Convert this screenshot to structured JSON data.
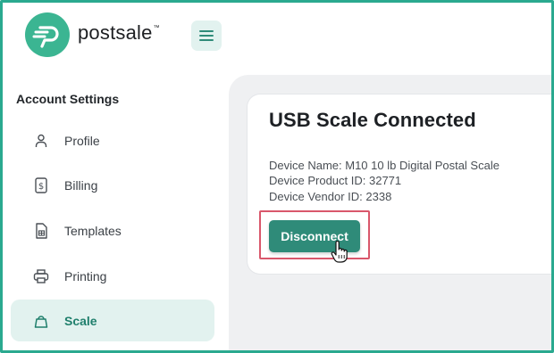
{
  "brand": {
    "name": "postsale",
    "trademark": "™",
    "accent": "#3bb592"
  },
  "header": {
    "menu_icon": "hamburger-icon"
  },
  "sidebar": {
    "title": "Account Settings",
    "items": [
      {
        "label": "Profile",
        "icon": "user-icon"
      },
      {
        "label": "Billing",
        "icon": "billing-icon"
      },
      {
        "label": "Templates",
        "icon": "template-icon"
      },
      {
        "label": "Printing",
        "icon": "printer-icon"
      },
      {
        "label": "Scale",
        "icon": "scale-icon",
        "active": true
      }
    ]
  },
  "main": {
    "card": {
      "title": "USB Scale Connected",
      "device_name": "Device Name: M10 10 lb Digital Postal Scale",
      "product_id": "Device Product ID: 32771",
      "vendor_id": "Device Vendor ID: 2338",
      "disconnect_label": "Disconnect"
    }
  },
  "colors": {
    "highlight": "#d9576b",
    "button": "#2f8b79",
    "frame": "#2aa98f"
  }
}
